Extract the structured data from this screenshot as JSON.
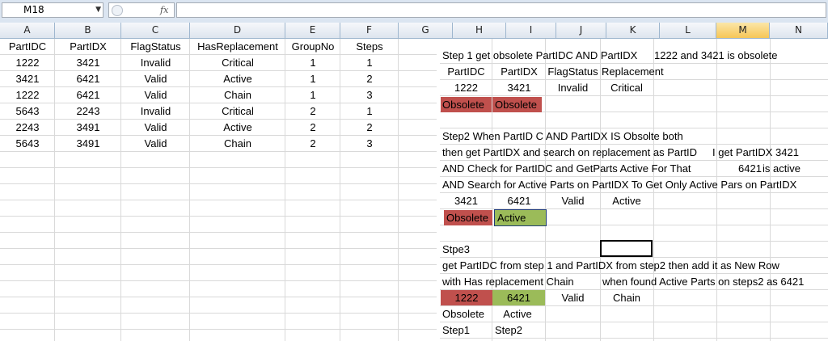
{
  "formula_bar": {
    "name_box": "M18",
    "fx": "fx",
    "content": ""
  },
  "columns": [
    "A",
    "B",
    "C",
    "D",
    "E",
    "F",
    "G",
    "H",
    "I",
    "J",
    "K",
    "L",
    "M",
    "N"
  ],
  "selected_column": "M",
  "table": {
    "headers": [
      "PartIDC",
      "PartIDX",
      "FlagStatus",
      "HasReplacement",
      "GroupNo",
      "Steps"
    ],
    "rows": [
      [
        "1222",
        "3421",
        "Invalid",
        "Critical",
        "1",
        "1"
      ],
      [
        "3421",
        "6421",
        "Valid",
        "Active",
        "1",
        "2"
      ],
      [
        "1222",
        "6421",
        "Valid",
        "Chain",
        "1",
        "3"
      ],
      [
        "5643",
        "2243",
        "Invalid",
        "Critical",
        "2",
        "1"
      ],
      [
        "2243",
        "3491",
        "Valid",
        "Active",
        "2",
        "2"
      ],
      [
        "5643",
        "3491",
        "Valid",
        "Chain",
        "2",
        "3"
      ]
    ]
  },
  "notes": {
    "step1_title": "Step 1 get obsolete PartIDC AND PartIDX",
    "step1_note": "1222 and 3421 is obsolete",
    "step1_headers": [
      "PartIDC",
      "PartIDX",
      "FlagStatus",
      "Replacement"
    ],
    "step1_values": [
      "1222",
      "3421",
      "Invalid",
      "Critical"
    ],
    "step1_tags": [
      "Obsolete",
      "Obsolete"
    ],
    "step2_line1": "Step2 When PartID C AND PartIDX IS Obsolte both",
    "step2_line2a": "then get PartIDX and search on replacement as PartID",
    "step2_line2b": "I get PartIDX 3421",
    "step2_line3a": "AND Check for PartIDC and GetParts Active For That",
    "step2_line3b": "6421",
    "step2_line3c": "is active",
    "step2_line4": "AND Search for Active Parts on PartIDX To Get Only Active Pars on PartIDX",
    "step2_values": [
      "3421",
      "6421",
      "Valid",
      "Active"
    ],
    "step2_tags": [
      "Obsolete",
      "Active"
    ],
    "step3_title": "Stpe3",
    "step3_line1": "get PartIDC from step 1 and PartIDX from step2 then add it as New Row",
    "step3_line2a": "with Has replacement Chain",
    "step3_line2b": "when found Active Parts on steps2 as 6421",
    "step3_values": [
      "1222",
      "6421",
      "Valid",
      "Chain"
    ],
    "step3_tags": [
      "Obsolete",
      "Active"
    ],
    "step3_sources": [
      "Step1",
      "Step2"
    ]
  },
  "colors": {
    "obsolete": "#c0504d",
    "active": "#9bbb59",
    "header_selected": "#f6c657"
  }
}
